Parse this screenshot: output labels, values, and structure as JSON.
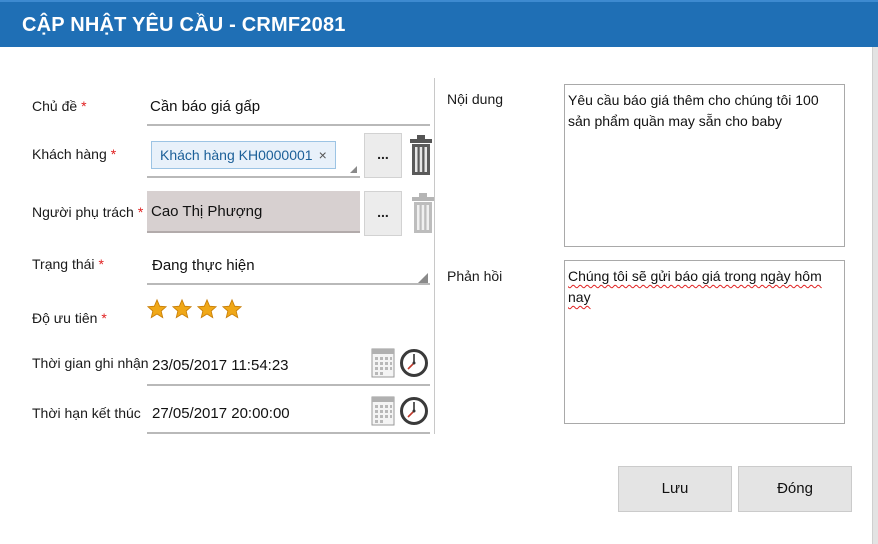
{
  "window": {
    "title": "CẬP NHẬT YÊU CẦU - CRMF2081"
  },
  "colors": {
    "titlebar": "#1f6fb5",
    "required": "#e02020",
    "star": "#f0a818"
  },
  "form": {
    "subject": {
      "label": "Chủ đề",
      "required": "*",
      "value": "Cần báo giá gấp"
    },
    "customer": {
      "label": "Khách hàng",
      "required": "*",
      "tag": "Khách hàng KH0000001",
      "tag_remove": "×",
      "browse": "..."
    },
    "owner": {
      "label": "Người phụ trách",
      "required": "*",
      "value": "Cao Thị Phượng",
      "browse": "..."
    },
    "status": {
      "label": "Trạng thái",
      "required": "*",
      "value": "Đang thực hiện"
    },
    "priority": {
      "label": "Độ ưu tiên",
      "required": "*",
      "stars": 4
    },
    "received_time": {
      "label": "Thời gian ghi nhận",
      "value": "23/05/2017 11:54:23"
    },
    "deadline": {
      "label": "Thời hạn kết thúc",
      "value": "27/05/2017 20:00:00"
    },
    "content": {
      "label": "Nội dung",
      "value": "Yêu cầu báo giá thêm cho chúng tôi 100 sản phẩm quần may sẵn cho baby"
    },
    "feedback": {
      "label": "Phản hồi",
      "value": "Chúng tôi sẽ gửi báo giá trong ngày hôm nay"
    }
  },
  "buttons": {
    "save": "Lưu",
    "close": "Đóng"
  }
}
